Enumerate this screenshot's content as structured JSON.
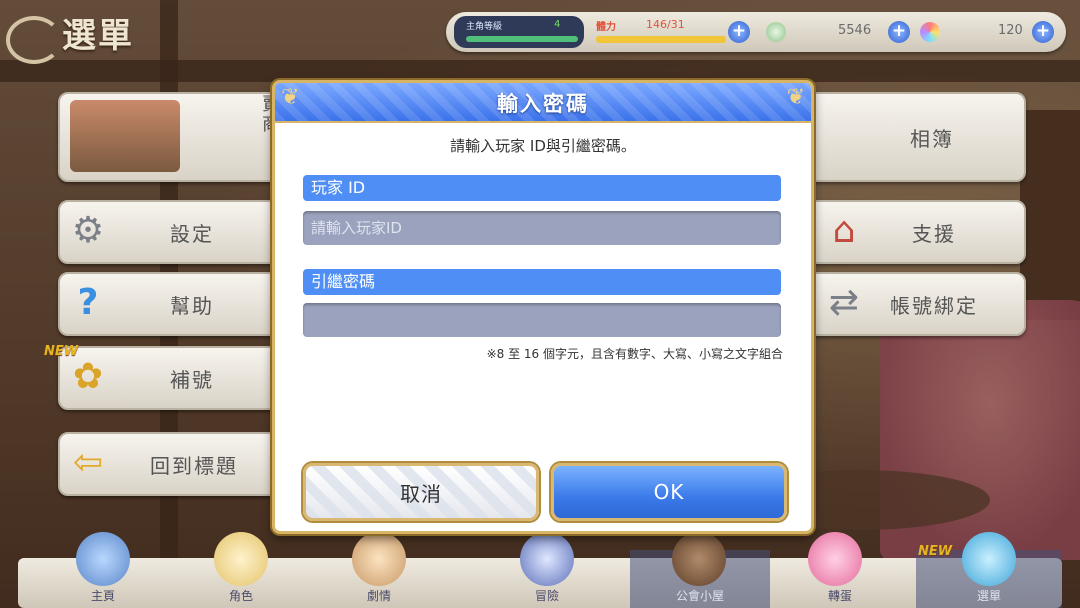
{
  "top": {
    "title": "選單",
    "level_label": "主角等級",
    "level_value": "4",
    "stamina_label": "體力",
    "stamina_value": "146/31",
    "coins": "5546",
    "gems": "120"
  },
  "left_menu": [
    {
      "label": "賣商",
      "icon": "shop-icon"
    },
    {
      "label": "設定",
      "icon": "gear-icon"
    },
    {
      "label": "幫助",
      "icon": "question-icon"
    },
    {
      "label": "補號",
      "icon": "ribbon-icon",
      "badge": "NEW"
    },
    {
      "label": "回到標題",
      "icon": "back-arrow-icon"
    }
  ],
  "right_menu": [
    {
      "label": "相簿",
      "icon": "album-icon"
    },
    {
      "label": "支援",
      "icon": "shop-stall-icon"
    },
    {
      "label": "帳號綁定",
      "icon": "link-devices-icon"
    }
  ],
  "bottom_nav": [
    {
      "label": "主頁"
    },
    {
      "label": "角色"
    },
    {
      "label": "劇情"
    },
    {
      "label": "冒險"
    },
    {
      "label": "公會小屋"
    },
    {
      "label": "轉蛋"
    },
    {
      "label": "選單",
      "badge": "NEW"
    }
  ],
  "dialog": {
    "title": "輸入密碼",
    "instruction": "請輸入玩家 ID與引繼密碼。",
    "player_id_label": "玩家 ID",
    "player_id_placeholder": "請輸入玩家ID",
    "player_id_value": "",
    "password_label": "引繼密碼",
    "password_value": "",
    "note": "※8 至 16 個字元，且含有數字、大寫、小寫之文字組合",
    "cancel_label": "取消",
    "ok_label": "OK"
  },
  "colors": {
    "dialog_header": "#3b72ea",
    "field_label_bg": "#4f8ff5",
    "field_bg": "#9aa2bd",
    "frame_gold": "#d7b565"
  }
}
